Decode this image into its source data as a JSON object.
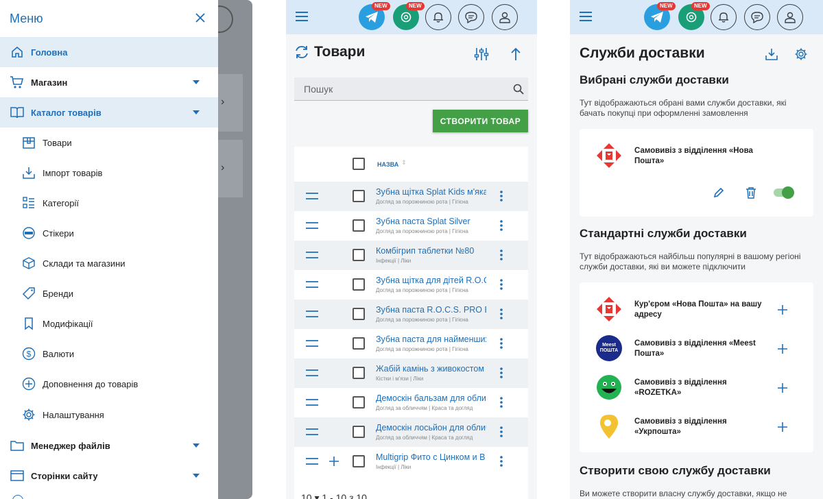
{
  "menu": {
    "title": "Меню",
    "items": [
      {
        "label": "Головна"
      },
      {
        "label": "Магазин"
      },
      {
        "label": "Каталог товарів"
      }
    ],
    "sub": [
      {
        "label": "Товари"
      },
      {
        "label": "Імпорт товарів"
      },
      {
        "label": "Категорії"
      },
      {
        "label": "Стікери"
      },
      {
        "label": "Склади та магазини"
      },
      {
        "label": "Бренди"
      },
      {
        "label": "Модифікації"
      },
      {
        "label": "Валюти"
      },
      {
        "label": "Доповнення до товарів"
      },
      {
        "label": "Налаштування"
      }
    ],
    "bottom": [
      {
        "label": "Менеджер файлів"
      },
      {
        "label": "Сторінки сайту"
      }
    ]
  },
  "topbar": {
    "badge": "NEW"
  },
  "products": {
    "title": "Товари",
    "search_placeholder": "Пошук",
    "create_label": "СТВОРИТИ ТОВАР",
    "col_name": "НАЗВА",
    "rows": [
      {
        "name": "Зубна щітка Splat Kids м'яка",
        "cat": "Догляд за порожниною рота | Гігієна"
      },
      {
        "name": "Зубна паста Splat Silver",
        "cat": "Догляд за порожниною рота | Гігієна"
      },
      {
        "name": "Комбігрип таблетки №80",
        "cat": "Інфекції | Ліки"
      },
      {
        "name": "Зубна щітка для дітей R.O.C.S.",
        "cat": "Догляд за порожниною рота | Гігієна"
      },
      {
        "name": "Зубна паста R.O.C.S. PRO Brackets",
        "cat": "Догляд за порожниною рота | Гігієна"
      },
      {
        "name": "Зубна паста для найменших",
        "cat": "Догляд за порожниною рота | Гігієна"
      },
      {
        "name": "Жабій камінь з живокостом",
        "cat": "Кістки і м'язи | Ліки"
      },
      {
        "name": "Демоскін бальзам для обличчя",
        "cat": "Догляд за обличчям | Краса та догляд"
      },
      {
        "name": "Демоскін лосьйон для обличчя",
        "cat": "Догляд за обличчям | Краса та догляд"
      },
      {
        "name": "Multigrip Фито с Цинком и B",
        "cat": "Інфекції | Ліки"
      }
    ],
    "pager": "10   ▾   1 - 10 з 10"
  },
  "delivery": {
    "title": "Служби доставки",
    "selected_title": "Вибрані служби доставки",
    "selected_desc": "Тут відображаються обрані вами служби доставки, які бачать покупці при оформленні замовлення",
    "selected": [
      {
        "name": "Самовивіз з відділення «Нова Пошта»",
        "enabled": true
      }
    ],
    "standard_title": "Стандартні служби доставки",
    "standard_desc": "Тут відображаються найбільш популярні в вашому регіоні служби доставки, які ви можете підключити",
    "standard": [
      {
        "name": "Кур'єром «Нова Пошта» на вашу адресу"
      },
      {
        "name": "Самовивіз з відділення «Meest Пошта»"
      },
      {
        "name": "Самовивіз з відділення «ROZETKA»"
      },
      {
        "name": "Самовивіз з відділення «Укрпошта»"
      }
    ],
    "meest_logo_text": "Meest ПОШТА",
    "create_title": "Створити свою службу доставки",
    "create_desc": "Ви можете створити власну службу доставки, якщо не"
  },
  "colors": {
    "accent": "#1e6fb8",
    "green": "#43a047",
    "topbar": "#d9e9f7",
    "novaposhta": "#e53935",
    "ukrposhta": "#f2c230"
  }
}
